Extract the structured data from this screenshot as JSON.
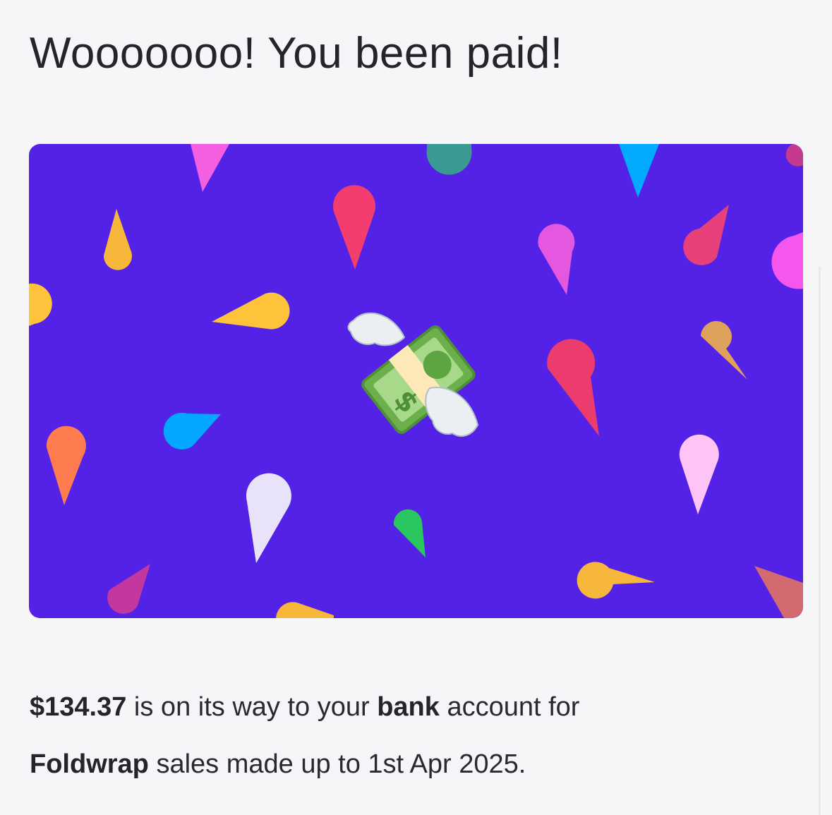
{
  "title": "Wooooooo! You been paid!",
  "banner": {
    "background_color": "#5421e6",
    "icon": "money-with-wings-icon"
  },
  "payout": {
    "amount": "$134.37",
    "text_before_bank": " is on its way to your ",
    "bank_word": "bank",
    "text_after_bank": " account for",
    "product": "Foldwrap",
    "text_after_product": " sales made up to 1st Apr 2025."
  }
}
